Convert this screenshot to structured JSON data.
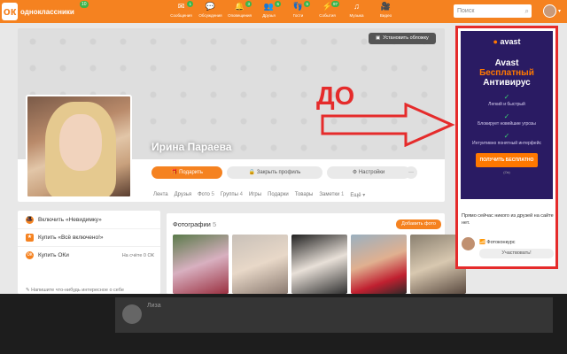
{
  "header": {
    "logo_text": "одноклассники",
    "logo_badge": "10",
    "nav": [
      {
        "label": "Сообщения",
        "icon": "envelope-icon",
        "glyph": "✉",
        "badge": "1"
      },
      {
        "label": "Обсуждения",
        "icon": "speech-bubbles-icon",
        "glyph": "💬",
        "badge": ""
      },
      {
        "label": "Оповещения",
        "icon": "bell-icon",
        "glyph": "🔔",
        "badge": "3"
      },
      {
        "label": "Друзья",
        "icon": "people-icon",
        "glyph": "👥",
        "badge": "5"
      },
      {
        "label": "Гости",
        "icon": "footprints-icon",
        "glyph": "👣",
        "badge": "5"
      },
      {
        "label": "События",
        "icon": "lightning-icon",
        "glyph": "⚡",
        "badge": "97"
      },
      {
        "label": "Музыка",
        "icon": "music-note-icon",
        "glyph": "♫",
        "badge": ""
      },
      {
        "label": "Видео",
        "icon": "video-camera-icon",
        "glyph": "🎥",
        "badge": ""
      }
    ],
    "search_placeholder": "Поиск"
  },
  "profile": {
    "set_cover_label": "Установить обложку",
    "name": "Ирина Параева",
    "actions": {
      "gift": "Подарить",
      "close_profile": "Закрыть профиль",
      "settings": "Настройки",
      "more": "···"
    },
    "tabs": [
      {
        "label": "Лента",
        "count": ""
      },
      {
        "label": "Друзья",
        "count": ""
      },
      {
        "label": "Фото",
        "count": "5"
      },
      {
        "label": "Группы",
        "count": "4"
      },
      {
        "label": "Игры",
        "count": ""
      },
      {
        "label": "Подарки",
        "count": ""
      },
      {
        "label": "Товары",
        "count": ""
      },
      {
        "label": "Заметки",
        "count": "1"
      },
      {
        "label": "Ещё",
        "count": "▾"
      }
    ]
  },
  "left_menu": {
    "items": [
      {
        "label": "Включить «Невидимку»",
        "right": "",
        "glyph": "🎩"
      },
      {
        "label": "Купить «Всё включено!»",
        "right": "",
        "glyph": "★"
      },
      {
        "label": "Купить ОКи",
        "right": "На счёте 0 ОК",
        "glyph": "ок"
      }
    ],
    "notify": "Напишите что-нибудь интересное о себе"
  },
  "photos": {
    "title": "Фотографии",
    "count": "5",
    "add_label": "Добавить фото"
  },
  "ad": {
    "logo": "avast",
    "headline": "Avast",
    "headline_orange": "Бесплатный",
    "headline_sub": "Антивирус",
    "features": [
      "Легкий и быстрый",
      "Блокирует новейшие угрозы",
      "Интуитивно понятный интерфейс"
    ],
    "cta": "ПОЛУЧИТЬ БЕСПЛАТНО",
    "small": "(Ок)",
    "friends_text": "Прямо сейчас никого из друзей на сайте нет.",
    "person_name": "Фотоконкурс",
    "participate": "Участвовать!"
  },
  "annotation": {
    "label": "ДО",
    "color": "#e52b2b"
  },
  "chat": {
    "name": "Лиза"
  },
  "colors": {
    "brand": "#f58220",
    "annotation": "#e52b2b"
  }
}
